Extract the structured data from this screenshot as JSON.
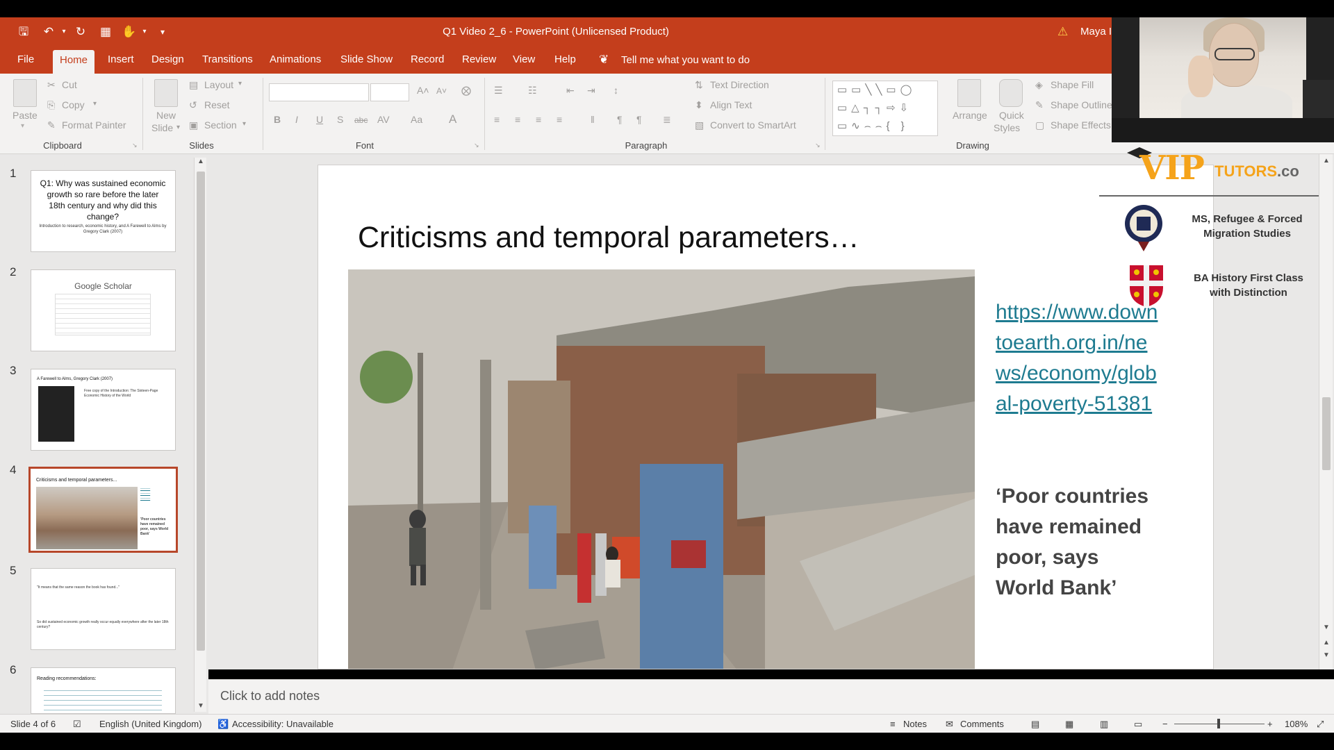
{
  "titlebar": {
    "document_title": "Q1 Video 2_6  -  PowerPoint (Unlicensed Product)",
    "user_name": "Maya I"
  },
  "menu": {
    "tabs": [
      "File",
      "Home",
      "Insert",
      "Design",
      "Transitions",
      "Animations",
      "Slide Show",
      "Record",
      "Review",
      "View",
      "Help"
    ],
    "active_tab": "Home",
    "tell_me": "Tell me what you want to do"
  },
  "ribbon": {
    "clipboard": {
      "label": "Clipboard",
      "paste": "Paste",
      "cut": "Cut",
      "copy": "Copy",
      "format_painter": "Format Painter"
    },
    "slides": {
      "label": "Slides",
      "new_slide": "New",
      "new_slide_2": "Slide",
      "layout": "Layout",
      "reset": "Reset",
      "section": "Section"
    },
    "font": {
      "label": "Font",
      "bold": "B",
      "italic": "I",
      "underline": "U",
      "shadow": "S",
      "strike": "abc",
      "spacing": "AV",
      "case": "Aa",
      "color": "A"
    },
    "paragraph": {
      "label": "Paragraph",
      "text_direction": "Text Direction",
      "align_text": "Align Text",
      "convert_smartart": "Convert to SmartArt"
    },
    "drawing": {
      "label": "Drawing",
      "arrange": "Arrange",
      "quick_styles": "Quick",
      "quick_styles_2": "Styles",
      "shape_fill": "Shape Fill",
      "shape_outline": "Shape Outline",
      "shape_effects": "Shape Effects"
    }
  },
  "thumbnails": [
    {
      "num": "1",
      "text": "Q1: Why was sustained economic growth so rare before the later 18th century and why did this change?",
      "sub": "Introduction to research, economic history, and A Farewell to Alms by Gregory Clark (2007)"
    },
    {
      "num": "2",
      "text": "Google Scholar",
      "sub": ""
    },
    {
      "num": "3",
      "text": "A Farewell to Alms, Gregory Clark (2007)",
      "sub": "Free copy of the Introduction: The Sixteen-Page Economic History of the World"
    },
    {
      "num": "4",
      "text": "Criticisms and temporal parameters...",
      "sub": "'Poor countries have remained poor, says World Bank'"
    },
    {
      "num": "5",
      "text": "\"It means that the same reason the book has found...\"",
      "sub": "So did sustained economic growth really occur equally everywhere after the later 18th century?"
    },
    {
      "num": "6",
      "text": "Reading recommendations:",
      "sub": ""
    }
  ],
  "slide": {
    "title": "Criticisms and temporal parameters…",
    "link": "https://www.downtoearth.org.in/news/economy/global-poverty-51381",
    "link_lines": [
      "https://www.down",
      "toearth.org.in/ne",
      "ws/economy/glob",
      "al-poverty-51381"
    ],
    "quote_lines": [
      "‘Poor countries",
      "have remained",
      "poor, says",
      "World Bank’"
    ]
  },
  "logo": {
    "brand": "VIP",
    "brand_suffix": "TUTORS",
    "brand_domain": ".co",
    "credential_1": "MS, Refugee & Forced Migration Studies",
    "credential_2": "BA History First Class with Distinction"
  },
  "notes": {
    "placeholder": "Click to add notes"
  },
  "statusbar": {
    "slide_count": "Slide 4 of 6",
    "language": "English (United Kingdom)",
    "accessibility": "Accessibility: Unavailable",
    "notes": "Notes",
    "comments": "Comments",
    "zoom": "108%"
  },
  "colors": {
    "accent": "#c43e1c",
    "link": "#1e7b90",
    "brand": "#f5a31a"
  }
}
